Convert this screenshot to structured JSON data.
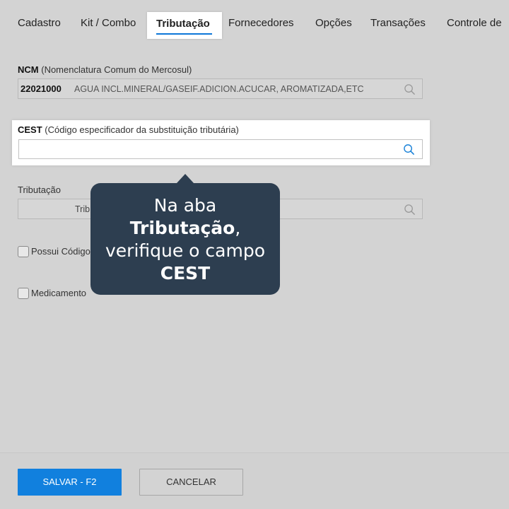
{
  "tabs": [
    {
      "label": "Cadastro"
    },
    {
      "label": "Kit / Combo"
    },
    {
      "label": "Tributação",
      "active": true
    },
    {
      "label": "Fornecedores"
    },
    {
      "label": "Opções"
    },
    {
      "label": "Transações"
    },
    {
      "label": "Controle de"
    }
  ],
  "ncm": {
    "label_bold": "NCM",
    "label_rest": "(Nomenclatura Comum do Mercosul)",
    "code": "22021000",
    "description": "AGUA INCL.MINERAL/GASEIF.ADICION.ACUCAR, AROMATIZADA,ETC"
  },
  "cest": {
    "label_bold": "CEST",
    "label_rest": "(Código especificador da substituição tributária)",
    "value": ""
  },
  "tributacao": {
    "label": "Tributação",
    "value": "Trib"
  },
  "checkboxes": [
    {
      "label": "Possui Código"
    },
    {
      "label": "Medicamento"
    }
  ],
  "footer": {
    "save_label": "SALVAR - F2",
    "cancel_label": "CANCELAR"
  },
  "tooltip": {
    "line1": "Na aba",
    "line2_bold": "Tributação",
    "line2_rest": ",",
    "line3": "verifique o campo",
    "line4_bold": "CEST"
  },
  "icons": {
    "search": "search-icon"
  },
  "colors": {
    "accent": "#0d77d8",
    "primary_button": "#1180de",
    "tooltip_bg": "#2d3e50",
    "overlay_bg": "#d3d3d3"
  }
}
